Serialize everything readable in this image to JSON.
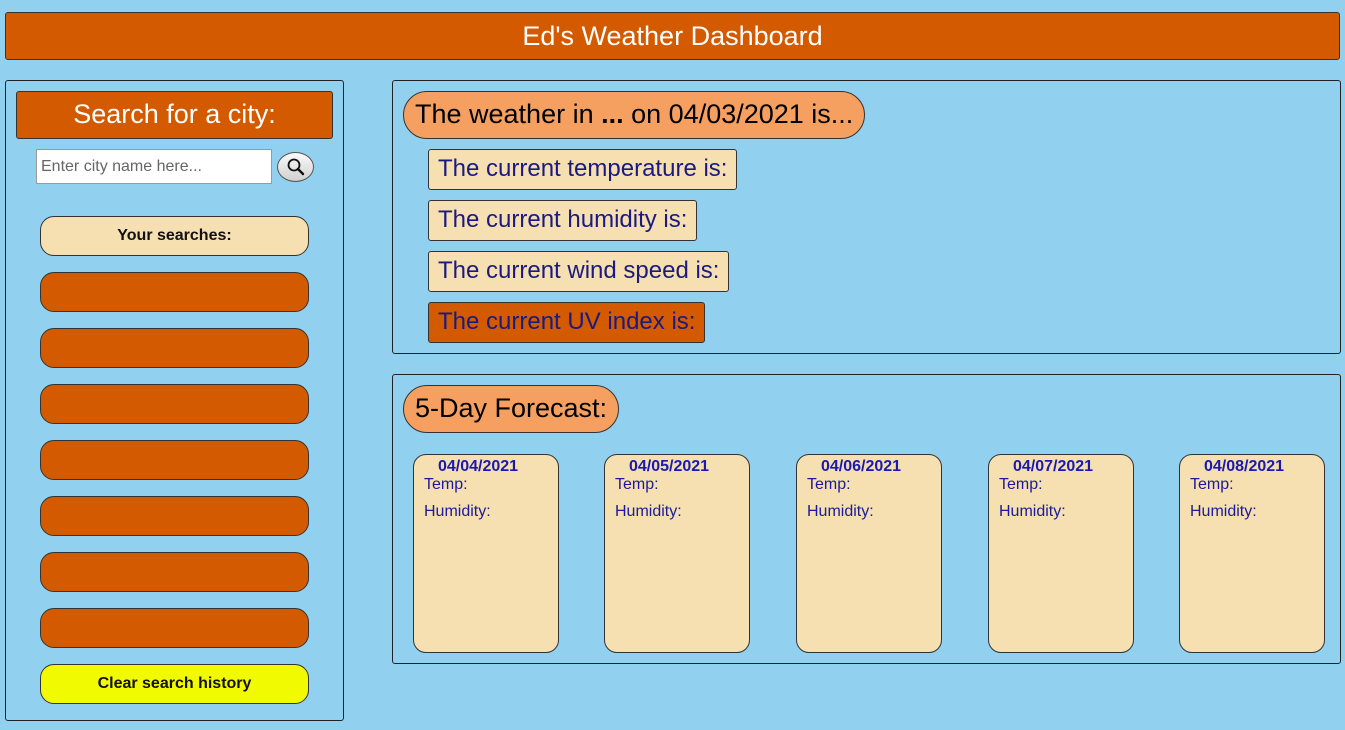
{
  "header": {
    "title": "Ed's Weather Dashboard"
  },
  "sidebar": {
    "title": "Search for a city:",
    "search_placeholder": "Enter city name here...",
    "search_value": "",
    "searches_label": "Your searches:",
    "history_items": [
      "",
      "",
      "",
      "",
      "",
      "",
      ""
    ],
    "clear_label": "Clear search history"
  },
  "current": {
    "title_prefix": "The weather in ",
    "city": "...",
    "title_suffix": " on 04/03/2021 is...",
    "temperature_label": "The current temperature is:",
    "humidity_label": "The current humidity is:",
    "wind_label": "The current wind speed is:",
    "uv_label": "The current UV index is:"
  },
  "forecast": {
    "title": "5-Day Forecast:",
    "days": [
      {
        "date": "04/04/2021",
        "temp_label": "Temp:",
        "humidity_label": "Humidity:"
      },
      {
        "date": "04/05/2021",
        "temp_label": "Temp:",
        "humidity_label": "Humidity:"
      },
      {
        "date": "04/06/2021",
        "temp_label": "Temp:",
        "humidity_label": "Humidity:"
      },
      {
        "date": "04/07/2021",
        "temp_label": "Temp:",
        "humidity_label": "Humidity:"
      },
      {
        "date": "04/08/2021",
        "temp_label": "Temp:",
        "humidity_label": "Humidity:"
      }
    ]
  },
  "colors": {
    "background": "#91d0ef",
    "accent_orange": "#d45a00",
    "title_pill": "#f5a060",
    "stat_bg": "#f6dfb0",
    "clear_button": "#f2fa00"
  },
  "icons": {
    "search_button": "magnifying-glass-icon"
  }
}
